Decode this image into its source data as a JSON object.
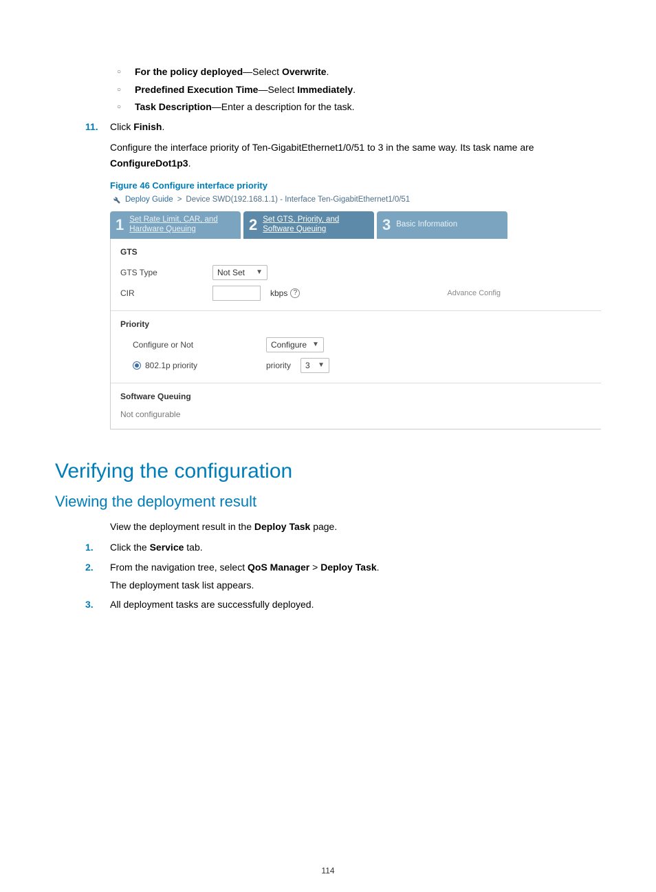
{
  "bullets": [
    {
      "bold_prefix": "For the policy deployed",
      "rest": "—Select ",
      "bold_mid": "Overwrite",
      "tail": "."
    },
    {
      "bold_prefix": "Predefined Execution Time",
      "rest": "—Select ",
      "bold_mid": "Immediately",
      "tail": "."
    },
    {
      "bold_prefix": "Task Description",
      "rest": "—Enter a description for the task.",
      "bold_mid": "",
      "tail": ""
    }
  ],
  "step11": {
    "num": "11.",
    "text_pre": "Click ",
    "bold": "Finish",
    "text_post": "."
  },
  "after_paragraph": {
    "text_a": "Configure the interface priority of Ten-GigabitEthernet1/0/51 to 3 in the same way. Its task name are ",
    "bold": "ConfigureDot1p3",
    "text_b": "."
  },
  "figcap": "Figure 46 Configure interface priority",
  "shot": {
    "crumb": {
      "link": "Deploy Guide",
      "sep": " > ",
      "rest": "Device SWD(192.168.1.1) - Interface Ten-GigabitEthernet1/0/51"
    },
    "tabs": [
      {
        "num": "1",
        "line1": "Set Rate Limit, CAR, and",
        "line2": "Hardware Queuing",
        "active": false,
        "underline": true
      },
      {
        "num": "2",
        "line1": "Set GTS, Priority, and",
        "line2": "Software Queuing",
        "active": true,
        "underline": true
      },
      {
        "num": "3",
        "line1": "Basic Information",
        "line2": "",
        "active": false,
        "underline": false
      }
    ],
    "gts": {
      "title": "GTS",
      "type_label": "GTS Type",
      "type_value": "Not Set",
      "cir_label": "CIR",
      "cir_value": "",
      "unit": "kbps",
      "adv": "Advance Config"
    },
    "priority": {
      "title": "Priority",
      "configure_label": "Configure or Not",
      "configure_value": "Configure",
      "radio_label": "802.1p priority",
      "priority_prefix": "priority",
      "priority_value": "3"
    },
    "swq": {
      "title": "Software Queuing",
      "note": "Not configurable"
    }
  },
  "h1": "Verifying the configuration",
  "h2": "Viewing the deployment result",
  "view_para": {
    "a": "View the deployment result in the ",
    "b": "Deploy Task",
    "c": " page."
  },
  "steps": [
    {
      "num": "1.",
      "pre": "Click the ",
      "b": "Service",
      "post": " tab."
    },
    {
      "num": "2.",
      "pre": "From the navigation tree, select ",
      "b": "QoS Manager",
      "mid": " > ",
      "b2": "Deploy Task",
      "post": ".",
      "extra": "The deployment task list appears."
    },
    {
      "num": "3.",
      "pre": "All deployment tasks are successfully deployed.",
      "b": "",
      "post": ""
    }
  ],
  "page_number": "114"
}
